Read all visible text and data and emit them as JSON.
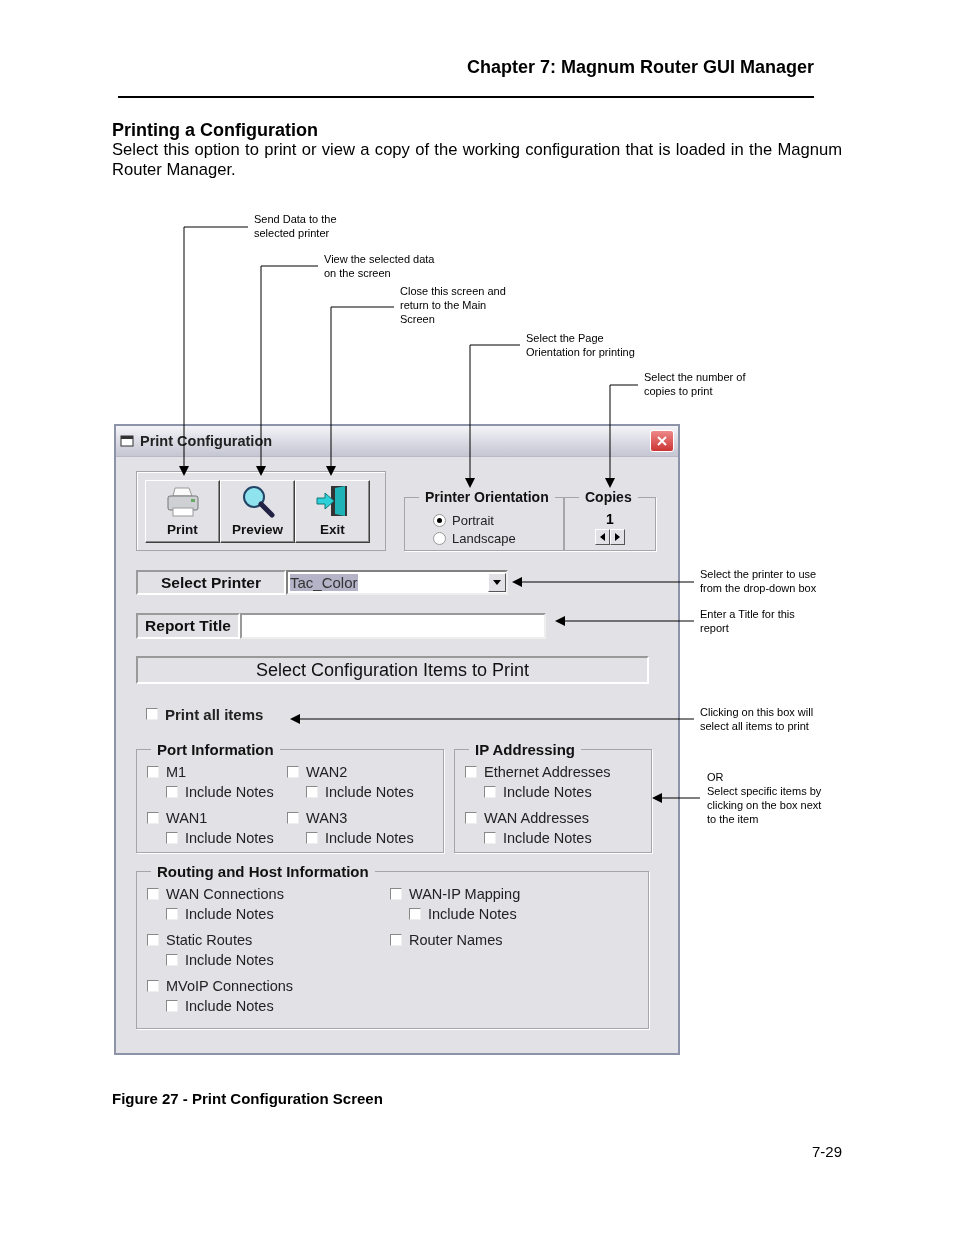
{
  "header": {
    "chapter": "Chapter 7: Magnum Router GUI Manager"
  },
  "section": {
    "title": "Printing a Configuration",
    "body": "Select this option to print or view a copy of the working configuration that is loaded in the Magnum Router Manager."
  },
  "window": {
    "title": "Print Configuration",
    "toolbar_buttons": [
      {
        "label": "Print",
        "kind": "print"
      },
      {
        "label": "Preview",
        "kind": "preview"
      },
      {
        "label": "Exit",
        "kind": "exit"
      }
    ],
    "orientation": {
      "label": "Printer Orientation",
      "options": [
        {
          "label": "Portrait",
          "selected": true
        },
        {
          "label": "Landscape",
          "selected": false
        }
      ]
    },
    "copies": {
      "label": "Copies",
      "value": "1"
    },
    "printer": {
      "label": "Select Printer",
      "value": "Tac_Color"
    },
    "report_title": {
      "label": "Report Title"
    },
    "banner": "Select Configuration Items to Print",
    "print_all": {
      "label": "Print all items",
      "checked": false
    },
    "groups": [
      {
        "title": "Port Information",
        "columns": [
          [
            {
              "label": "M1",
              "checked": false,
              "children": [
                {
                  "label": "Include Notes",
                  "checked": false
                }
              ]
            },
            {
              "label": "WAN1",
              "checked": false,
              "children": [
                {
                  "label": "Include Notes",
                  "checked": false
                }
              ]
            }
          ],
          [
            {
              "label": "WAN2",
              "checked": false,
              "children": [
                {
                  "label": "Include Notes",
                  "checked": false
                }
              ]
            },
            {
              "label": "WAN3",
              "checked": false,
              "children": [
                {
                  "label": "Include Notes",
                  "checked": false
                }
              ]
            }
          ]
        ]
      },
      {
        "title": "IP Addressing",
        "columns": [
          [
            {
              "label": "Ethernet Addresses",
              "checked": false,
              "children": [
                {
                  "label": "Include Notes",
                  "checked": false
                }
              ]
            },
            {
              "label": "WAN Addresses",
              "checked": false,
              "children": [
                {
                  "label": "Include Notes",
                  "checked": false
                }
              ]
            }
          ]
        ]
      },
      {
        "title": "Routing and Host Information",
        "columns": [
          [
            {
              "label": "WAN Connections",
              "checked": false,
              "children": [
                {
                  "label": "Include Notes",
                  "checked": false
                }
              ]
            },
            {
              "label": "Static Routes",
              "checked": false,
              "children": [
                {
                  "label": "Include Notes",
                  "checked": false
                }
              ]
            },
            {
              "label": "MVoIP Connections",
              "checked": false,
              "children": [
                {
                  "label": "Include Notes",
                  "checked": false
                }
              ]
            }
          ],
          [
            {
              "label": "WAN-IP Mapping",
              "checked": false,
              "children": [
                {
                  "label": "Include Notes",
                  "checked": false
                }
              ]
            },
            {
              "label": "Router Names",
              "checked": false
            }
          ]
        ]
      }
    ]
  },
  "callouts": [
    {
      "lines": [
        "Send Data to the",
        "selected printer"
      ]
    },
    {
      "lines": [
        "View the selected data",
        "on the screen"
      ]
    },
    {
      "lines": [
        "Close this screen and",
        "return to the Main",
        "Screen"
      ]
    },
    {
      "lines": [
        "Select the Page",
        "Orientation for printing"
      ]
    },
    {
      "lines": [
        "Select the number of",
        "copies to print"
      ]
    },
    {
      "lines": [
        "Select the printer to use",
        "from the drop-down box"
      ]
    },
    {
      "lines": [
        "Enter a Title for this",
        "report"
      ]
    },
    {
      "lines": [
        "Clicking on this box will",
        "select all items to print"
      ]
    },
    {
      "lines": [
        "OR",
        "Select specific items by",
        "clicking on the box next",
        "to the item"
      ]
    }
  ],
  "caption": "Figure 27 - Print Configuration Screen",
  "page_number": "7-29"
}
